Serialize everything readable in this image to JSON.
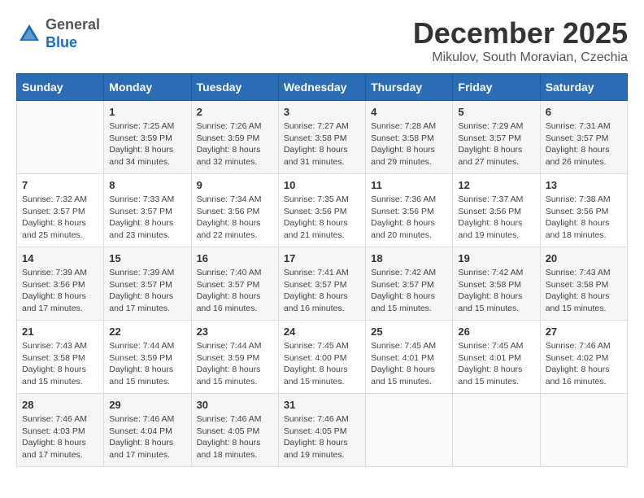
{
  "header": {
    "logo_line1": "General",
    "logo_line2": "Blue",
    "month": "December 2025",
    "location": "Mikulov, South Moravian, Czechia"
  },
  "weekdays": [
    "Sunday",
    "Monday",
    "Tuesday",
    "Wednesday",
    "Thursday",
    "Friday",
    "Saturday"
  ],
  "weeks": [
    [
      {
        "day": "",
        "info": ""
      },
      {
        "day": "1",
        "info": "Sunrise: 7:25 AM\nSunset: 3:59 PM\nDaylight: 8 hours\nand 34 minutes."
      },
      {
        "day": "2",
        "info": "Sunrise: 7:26 AM\nSunset: 3:59 PM\nDaylight: 8 hours\nand 32 minutes."
      },
      {
        "day": "3",
        "info": "Sunrise: 7:27 AM\nSunset: 3:58 PM\nDaylight: 8 hours\nand 31 minutes."
      },
      {
        "day": "4",
        "info": "Sunrise: 7:28 AM\nSunset: 3:58 PM\nDaylight: 8 hours\nand 29 minutes."
      },
      {
        "day": "5",
        "info": "Sunrise: 7:29 AM\nSunset: 3:57 PM\nDaylight: 8 hours\nand 27 minutes."
      },
      {
        "day": "6",
        "info": "Sunrise: 7:31 AM\nSunset: 3:57 PM\nDaylight: 8 hours\nand 26 minutes."
      }
    ],
    [
      {
        "day": "7",
        "info": "Sunrise: 7:32 AM\nSunset: 3:57 PM\nDaylight: 8 hours\nand 25 minutes."
      },
      {
        "day": "8",
        "info": "Sunrise: 7:33 AM\nSunset: 3:57 PM\nDaylight: 8 hours\nand 23 minutes."
      },
      {
        "day": "9",
        "info": "Sunrise: 7:34 AM\nSunset: 3:56 PM\nDaylight: 8 hours\nand 22 minutes."
      },
      {
        "day": "10",
        "info": "Sunrise: 7:35 AM\nSunset: 3:56 PM\nDaylight: 8 hours\nand 21 minutes."
      },
      {
        "day": "11",
        "info": "Sunrise: 7:36 AM\nSunset: 3:56 PM\nDaylight: 8 hours\nand 20 minutes."
      },
      {
        "day": "12",
        "info": "Sunrise: 7:37 AM\nSunset: 3:56 PM\nDaylight: 8 hours\nand 19 minutes."
      },
      {
        "day": "13",
        "info": "Sunrise: 7:38 AM\nSunset: 3:56 PM\nDaylight: 8 hours\nand 18 minutes."
      }
    ],
    [
      {
        "day": "14",
        "info": "Sunrise: 7:39 AM\nSunset: 3:56 PM\nDaylight: 8 hours\nand 17 minutes."
      },
      {
        "day": "15",
        "info": "Sunrise: 7:39 AM\nSunset: 3:57 PM\nDaylight: 8 hours\nand 17 minutes."
      },
      {
        "day": "16",
        "info": "Sunrise: 7:40 AM\nSunset: 3:57 PM\nDaylight: 8 hours\nand 16 minutes."
      },
      {
        "day": "17",
        "info": "Sunrise: 7:41 AM\nSunset: 3:57 PM\nDaylight: 8 hours\nand 16 minutes."
      },
      {
        "day": "18",
        "info": "Sunrise: 7:42 AM\nSunset: 3:57 PM\nDaylight: 8 hours\nand 15 minutes."
      },
      {
        "day": "19",
        "info": "Sunrise: 7:42 AM\nSunset: 3:58 PM\nDaylight: 8 hours\nand 15 minutes."
      },
      {
        "day": "20",
        "info": "Sunrise: 7:43 AM\nSunset: 3:58 PM\nDaylight: 8 hours\nand 15 minutes."
      }
    ],
    [
      {
        "day": "21",
        "info": "Sunrise: 7:43 AM\nSunset: 3:58 PM\nDaylight: 8 hours\nand 15 minutes."
      },
      {
        "day": "22",
        "info": "Sunrise: 7:44 AM\nSunset: 3:59 PM\nDaylight: 8 hours\nand 15 minutes."
      },
      {
        "day": "23",
        "info": "Sunrise: 7:44 AM\nSunset: 3:59 PM\nDaylight: 8 hours\nand 15 minutes."
      },
      {
        "day": "24",
        "info": "Sunrise: 7:45 AM\nSunset: 4:00 PM\nDaylight: 8 hours\nand 15 minutes."
      },
      {
        "day": "25",
        "info": "Sunrise: 7:45 AM\nSunset: 4:01 PM\nDaylight: 8 hours\nand 15 minutes."
      },
      {
        "day": "26",
        "info": "Sunrise: 7:45 AM\nSunset: 4:01 PM\nDaylight: 8 hours\nand 15 minutes."
      },
      {
        "day": "27",
        "info": "Sunrise: 7:46 AM\nSunset: 4:02 PM\nDaylight: 8 hours\nand 16 minutes."
      }
    ],
    [
      {
        "day": "28",
        "info": "Sunrise: 7:46 AM\nSunset: 4:03 PM\nDaylight: 8 hours\nand 17 minutes."
      },
      {
        "day": "29",
        "info": "Sunrise: 7:46 AM\nSunset: 4:04 PM\nDaylight: 8 hours\nand 17 minutes."
      },
      {
        "day": "30",
        "info": "Sunrise: 7:46 AM\nSunset: 4:05 PM\nDaylight: 8 hours\nand 18 minutes."
      },
      {
        "day": "31",
        "info": "Sunrise: 7:46 AM\nSunset: 4:05 PM\nDaylight: 8 hours\nand 19 minutes."
      },
      {
        "day": "",
        "info": ""
      },
      {
        "day": "",
        "info": ""
      },
      {
        "day": "",
        "info": ""
      }
    ]
  ]
}
